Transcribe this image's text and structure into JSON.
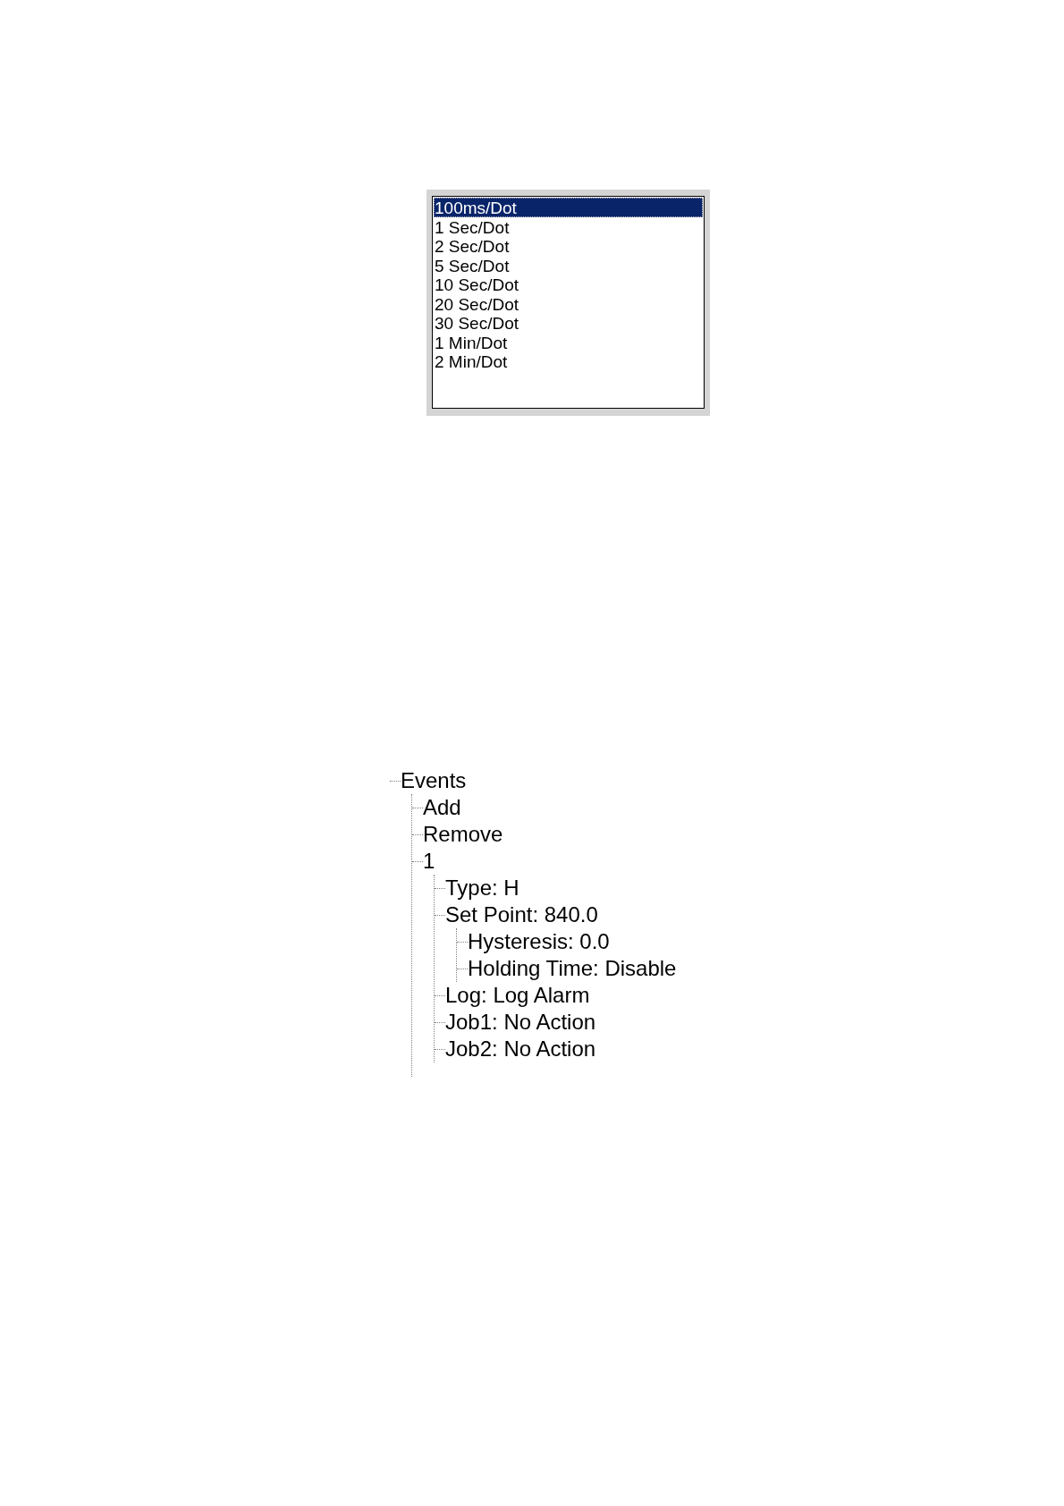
{
  "listbox": {
    "items": [
      {
        "label": "100ms/Dot",
        "selected": true
      },
      {
        "label": "1 Sec/Dot",
        "selected": false
      },
      {
        "label": "2 Sec/Dot",
        "selected": false
      },
      {
        "label": "5 Sec/Dot",
        "selected": false
      },
      {
        "label": "10 Sec/Dot",
        "selected": false
      },
      {
        "label": "20 Sec/Dot",
        "selected": false
      },
      {
        "label": "30 Sec/Dot",
        "selected": false
      },
      {
        "label": "1 Min/Dot",
        "selected": false
      },
      {
        "label": "2 Min/Dot",
        "selected": false
      }
    ]
  },
  "tree": {
    "items": [
      {
        "label": "Events",
        "children": [
          {
            "label": "Add"
          },
          {
            "label": "Remove"
          },
          {
            "label": "1",
            "children": [
              {
                "label": "Type: H"
              },
              {
                "label": "Set Point: 840.0",
                "children": [
                  {
                    "label": "Hysteresis: 0.0"
                  },
                  {
                    "label": "Holding Time: Disable"
                  }
                ]
              },
              {
                "label": "Log: Log Alarm"
              },
              {
                "label": "Job1: No Action"
              },
              {
                "label": "Job2: No Action"
              }
            ]
          }
        ]
      }
    ]
  }
}
